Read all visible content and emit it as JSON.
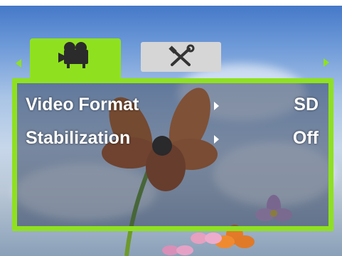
{
  "menu": {
    "tabs": [
      {
        "name": "video-tab",
        "icon": "video-camera-icon",
        "selected": true
      },
      {
        "name": "settings-tab",
        "icon": "tools-icon",
        "selected": false
      }
    ],
    "items": [
      {
        "label": "Video Format",
        "value": "SD"
      },
      {
        "label": "Stabilization",
        "value": "Off"
      }
    ]
  },
  "colors": {
    "accent": "#8fe11f",
    "inactive_tab": "#d6d6d6",
    "text": "#ffffff"
  }
}
